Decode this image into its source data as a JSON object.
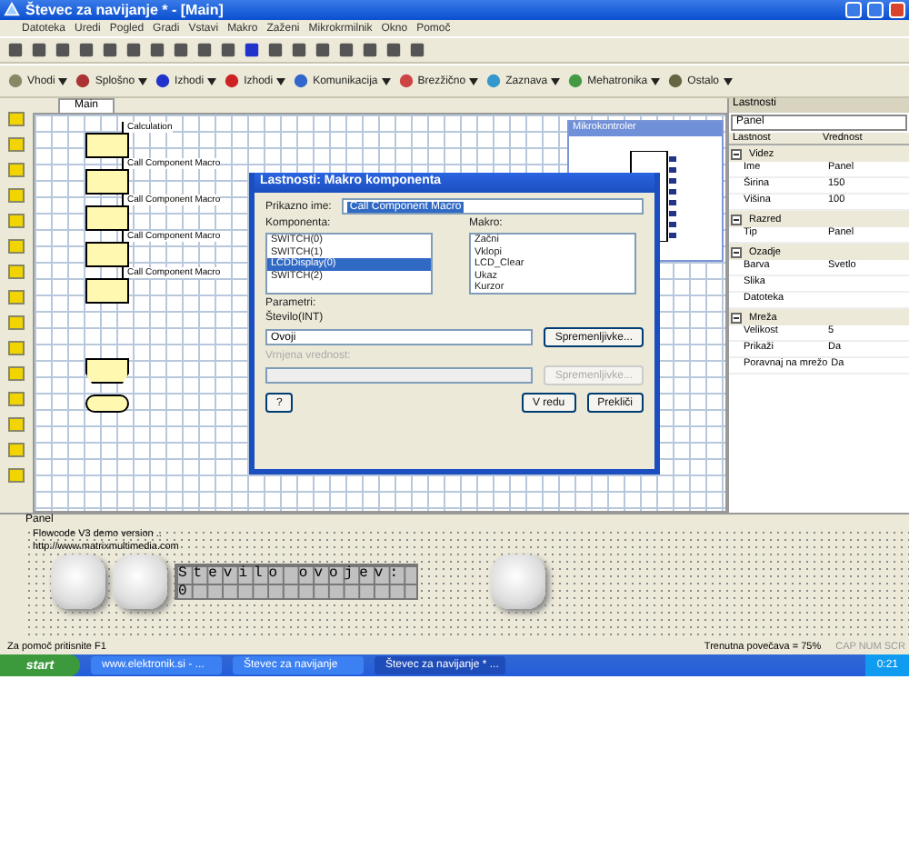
{
  "window": {
    "title": "Števec za navijanje * - [Main]"
  },
  "menu": [
    "Datoteka",
    "Uredi",
    "Pogled",
    "Gradi",
    "Vstavi",
    "Makro",
    "Zaženi",
    "Mikrokrmilnik",
    "Okno",
    "Pomoč"
  ],
  "component_toolbar": [
    "Vhodi",
    "Splošno",
    "Izhodi",
    "Izhodi",
    "Komunikacija",
    "Brezžično",
    "Zaznava",
    "Mehatronika",
    "Ostalo"
  ],
  "editor": {
    "tab": {
      "label": "Main",
      "selected": true
    },
    "flowchart": [
      {
        "kind": "label",
        "text": "Calculation"
      },
      {
        "kind": "block"
      },
      {
        "kind": "label",
        "text": "Call Component Macro"
      },
      {
        "kind": "block"
      },
      {
        "kind": "label",
        "text": "Call Component Macro"
      },
      {
        "kind": "block"
      },
      {
        "kind": "label",
        "text": "Call Component Macro"
      },
      {
        "kind": "block"
      },
      {
        "kind": "label",
        "text": "Call Component Macro"
      },
      {
        "kind": "block"
      },
      {
        "kind": "loop"
      },
      {
        "kind": "end"
      }
    ]
  },
  "mini_controller": {
    "title": "Mikrokontroler"
  },
  "dialog": {
    "title": "Lastnosti: Makro komponenta",
    "display_name_label": "Prikazno ime:",
    "display_name": "Call Component Macro",
    "component_label": "Komponenta:",
    "components": [
      {
        "label": "SWITCH(0)",
        "selected": false
      },
      {
        "label": "SWITCH(1)",
        "selected": false
      },
      {
        "label": "LCDDisplay(0)",
        "selected": true
      },
      {
        "label": "SWITCH(2)",
        "selected": false
      }
    ],
    "macro_label": "Makro:",
    "macros": [
      {
        "label": "Začni",
        "selected": false
      },
      {
        "label": "Vklopi",
        "selected": false
      },
      {
        "label": "LCD_Clear",
        "selected": false
      },
      {
        "label": "Ukaz",
        "selected": false
      },
      {
        "label": "Kurzor",
        "selected": false
      }
    ],
    "params_label": "Parametri:",
    "params_type": "Število(INT)",
    "params_value": "Ovoji",
    "variables_button": "Spremenljivke...",
    "return_label": "Vrnjena vrednost:",
    "return_button": "Spremenljivke...",
    "help_button": "?",
    "ok_button": "V redu",
    "cancel_button": "Prekliči"
  },
  "properties": {
    "title": "Lastnosti",
    "object": "Panel",
    "columns": [
      "Lastnost",
      "Vrednost"
    ],
    "groups": [
      {
        "name": "Videz",
        "expanded": true,
        "rows": [
          {
            "name": "Ime",
            "value": "Panel"
          },
          {
            "name": "Širina",
            "value": "150"
          },
          {
            "name": "Višina",
            "value": "100"
          }
        ]
      },
      {
        "name": "Razred",
        "expanded": true,
        "rows": [
          {
            "name": "Tip",
            "value": "Panel"
          }
        ]
      },
      {
        "name": "Ozadje",
        "expanded": true,
        "rows": [
          {
            "name": "Barva",
            "value": "Svetlo"
          },
          {
            "name": "Slika",
            "value": ""
          },
          {
            "name": "Datoteka",
            "value": ""
          }
        ]
      },
      {
        "name": "Mreža",
        "expanded": true,
        "rows": [
          {
            "name": "Velikost",
            "value": "5"
          },
          {
            "name": "Prikaži",
            "value": "Da"
          },
          {
            "name": "Poravnaj na mrežo",
            "value": "Da"
          }
        ]
      }
    ]
  },
  "panel": {
    "title": "Panel",
    "lines": [
      "Flowcode V3 demo version ..",
      "http://www.matrixmultimedia.com"
    ],
    "lcd": [
      "Stevilo ovojev:",
      "0"
    ]
  },
  "status_bar": {
    "left": "Za pomoč pritisnite F1",
    "zoom": "Trenutna povečava = 75%",
    "keys": "CAP NUM SCR"
  },
  "taskbar": {
    "start": "start",
    "tasks": [
      {
        "label": "www.elektronik.si - ...",
        "selected": false
      },
      {
        "label": "Števec za navijanje",
        "selected": false
      },
      {
        "label": "Števec za navijanje * ...",
        "selected": true
      }
    ],
    "clock": "0:21"
  }
}
